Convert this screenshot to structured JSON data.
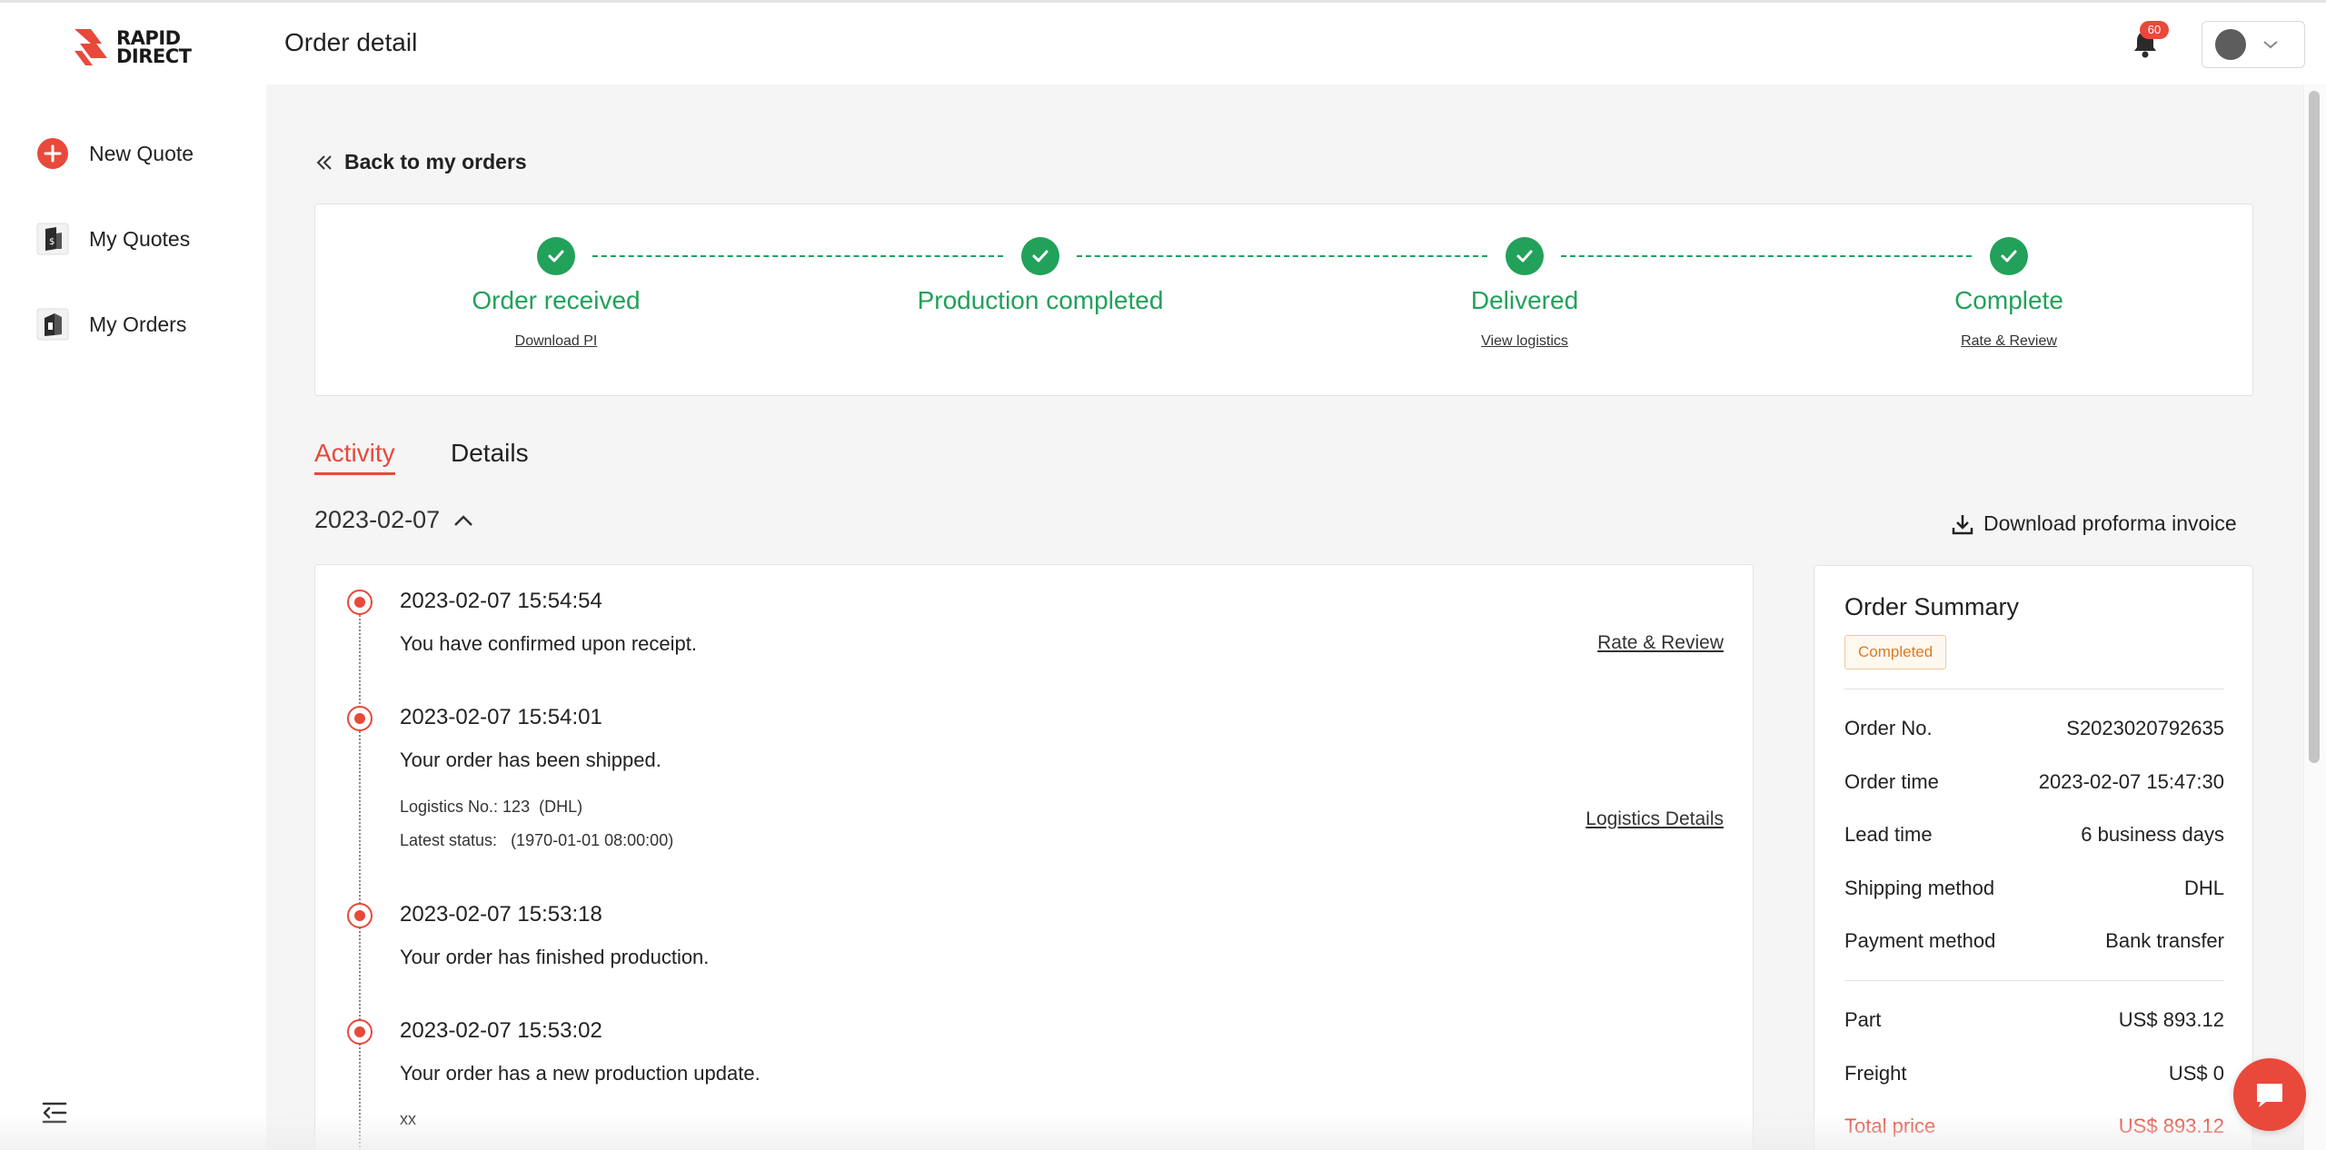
{
  "brand": {
    "line1": "RAPID",
    "line2": "DIRECT",
    "accent_color": "#e8493a"
  },
  "sidebar": {
    "items": [
      {
        "label": "New Quote",
        "icon": "plus-circle-icon"
      },
      {
        "label": "My Quotes",
        "icon": "quote-doc-icon"
      },
      {
        "label": "My Orders",
        "icon": "order-box-icon"
      }
    ]
  },
  "header": {
    "title": "Order detail",
    "notification_count": "60"
  },
  "back": {
    "label": "Back to my orders"
  },
  "progress": {
    "color": "#22a15a",
    "steps": [
      {
        "label": "Order received",
        "link": "Download PI"
      },
      {
        "label": "Production completed",
        "link": ""
      },
      {
        "label": "Delivered",
        "link": "View logistics"
      },
      {
        "label": "Complete",
        "link": "Rate & Review"
      }
    ]
  },
  "tabs": [
    {
      "label": "Activity"
    },
    {
      "label": "Details"
    }
  ],
  "activity": {
    "date": "2023-02-07",
    "download_label": "Download proforma invoice",
    "events": [
      {
        "time": "2023-02-07 15:54:54",
        "message": "You have confirmed upon receipt.",
        "link": "Rate & Review"
      },
      {
        "time": "2023-02-07 15:54:01",
        "message": "Your order has been shipped.",
        "logistics_no": "Logistics No.: 123  (DHL)",
        "latest_status": "Latest status:   (1970-01-01 08:00:00)",
        "link": "Logistics Details"
      },
      {
        "time": "2023-02-07 15:53:18",
        "message": "Your order has finished production."
      },
      {
        "time": "2023-02-07 15:53:02",
        "message": "Your order has a new production update.",
        "note": "xx"
      }
    ]
  },
  "summary": {
    "title": "Order Summary",
    "status": "Completed",
    "rows": [
      {
        "label": "Order No.",
        "value": "S2023020792635"
      },
      {
        "label": "Order time",
        "value": "2023-02-07 15:47:30"
      },
      {
        "label": "Lead time",
        "value": "6 business days"
      },
      {
        "label": "Shipping method",
        "value": "DHL"
      },
      {
        "label": "Payment method",
        "value": "Bank transfer"
      }
    ],
    "costs": [
      {
        "label": "Part",
        "value": "US$ 893.12"
      },
      {
        "label": "Freight",
        "value": "US$ 0"
      },
      {
        "label": "Total price",
        "value": "US$ 893.12"
      }
    ]
  }
}
